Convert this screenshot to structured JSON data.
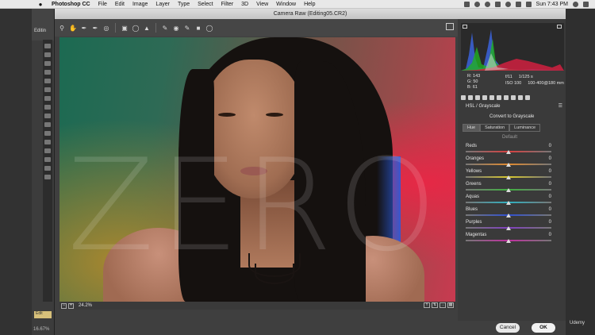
{
  "menubar": {
    "apple": "",
    "app": "Photoshop CC",
    "items": [
      "File",
      "Edit",
      "Image",
      "Layer",
      "Type",
      "Select",
      "Filter",
      "3D",
      "View",
      "Window",
      "Help"
    ],
    "clock": "Sun 7:43 PM"
  },
  "photoshop": {
    "doc_tab": "Editin",
    "doc_thumb": "Edit",
    "zoom_status": "16.67%"
  },
  "dialog": {
    "title": "Camera Raw (Editing05.CR2)",
    "zoom": "24.2%",
    "watermark": "ZERO",
    "cancel_label": "Cancel",
    "ok_label": "OK"
  },
  "info": {
    "r": "R:  143",
    "g": "G:   50",
    "b": "B:   61",
    "aperture": "f/11",
    "shutter": "1/125 s",
    "iso": "ISO 100",
    "lens": "100-400@180 mm"
  },
  "panel": {
    "section_title": "HSL / Grayscale",
    "convert_label": "Convert to Grayscale",
    "tabs": [
      "Hue",
      "Saturation",
      "Luminance"
    ],
    "default_label": "Default",
    "sliders": [
      {
        "label": "Reds",
        "value": "0",
        "color": "#d84040"
      },
      {
        "label": "Oranges",
        "value": "0",
        "color": "#e08a30"
      },
      {
        "label": "Yellows",
        "value": "0",
        "color": "#d8c830"
      },
      {
        "label": "Greens",
        "value": "0",
        "color": "#40b040"
      },
      {
        "label": "Aquas",
        "value": "0",
        "color": "#30b0c0"
      },
      {
        "label": "Blues",
        "value": "0",
        "color": "#3050d0"
      },
      {
        "label": "Purples",
        "value": "0",
        "color": "#8040c0"
      },
      {
        "label": "Magentas",
        "value": "0",
        "color": "#c030a0"
      }
    ]
  },
  "branding": {
    "udemy": "Udemy"
  }
}
